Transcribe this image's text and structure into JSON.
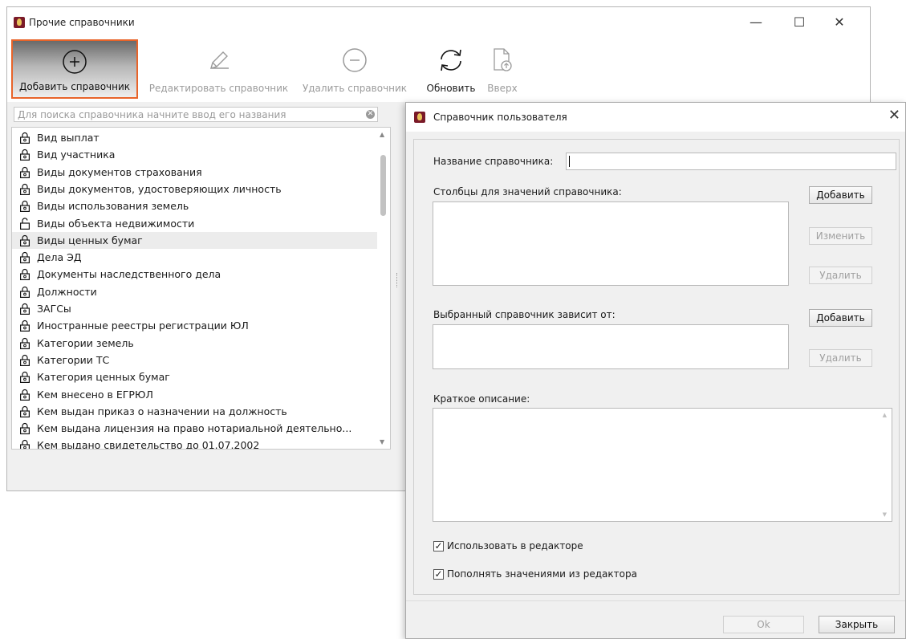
{
  "main_window": {
    "title": "Прочие справочники",
    "controls": {
      "minimize": "—",
      "maximize": "☐",
      "close": "✕"
    }
  },
  "toolbar": {
    "add": {
      "label": "Добавить справочник",
      "icon": "plus-circle-icon"
    },
    "edit": {
      "label": "Редактировать справочник",
      "icon": "pencil-icon"
    },
    "delete": {
      "label": "Удалить справочник",
      "icon": "minus-circle-icon"
    },
    "refresh": {
      "label": "Обновить",
      "icon": "refresh-icon"
    },
    "up": {
      "label": "Вверх",
      "icon": "file-up-icon"
    }
  },
  "search": {
    "placeholder": "Для поиска справочника начните ввод его названия"
  },
  "list": {
    "items": [
      {
        "label": "Вид выплат",
        "locked": true
      },
      {
        "label": "Вид участника",
        "locked": true
      },
      {
        "label": "Виды документов страхования",
        "locked": true
      },
      {
        "label": "Виды документов, удостоверяющих личность",
        "locked": true
      },
      {
        "label": "Виды использования земель",
        "locked": true
      },
      {
        "label": "Виды объекта недвижимости",
        "locked": false
      },
      {
        "label": "Виды ценных бумаг",
        "locked": true,
        "selected": true
      },
      {
        "label": "Дела ЭД",
        "locked": true
      },
      {
        "label": "Документы наследственного дела",
        "locked": true
      },
      {
        "label": "Должности",
        "locked": true
      },
      {
        "label": "ЗАГСы",
        "locked": true
      },
      {
        "label": "Иностранные реестры регистрации ЮЛ",
        "locked": true
      },
      {
        "label": "Категории земель",
        "locked": true
      },
      {
        "label": "Категории ТС",
        "locked": true
      },
      {
        "label": "Категория ценных бумаг",
        "locked": true
      },
      {
        "label": "Кем внесено в ЕГРЮЛ",
        "locked": true
      },
      {
        "label": "Кем выдан приказ о назначении на должность",
        "locked": true
      },
      {
        "label": "Кем выдана лицензия на право нотариальной деятельно...",
        "locked": true
      },
      {
        "label": "Кем выдано свидетельство до 01.07.2002",
        "locked": true
      }
    ]
  },
  "dialog": {
    "title": "Справочник пользователя",
    "close": "✕",
    "name_label": "Название справочника:",
    "name_value": "",
    "columns_label": "Столбцы для значений справочника:",
    "columns_add": "Добавить",
    "columns_edit": "Изменить",
    "columns_delete": "Удалить",
    "depends_label": "Выбранный справочник зависит от:",
    "depends_add": "Добавить",
    "depends_delete": "Удалить",
    "description_label": "Краткое описание:",
    "description_value": "",
    "use_in_editor": {
      "label": "Использовать в редакторе",
      "checked": true
    },
    "fill_from_editor": {
      "label": "Пополнять значениями из редактора",
      "checked": true
    },
    "ok": "Ok",
    "close_button": "Закрыть"
  },
  "colors": {
    "active_border": "#e8642a",
    "app_icon": "#7a1a28"
  }
}
